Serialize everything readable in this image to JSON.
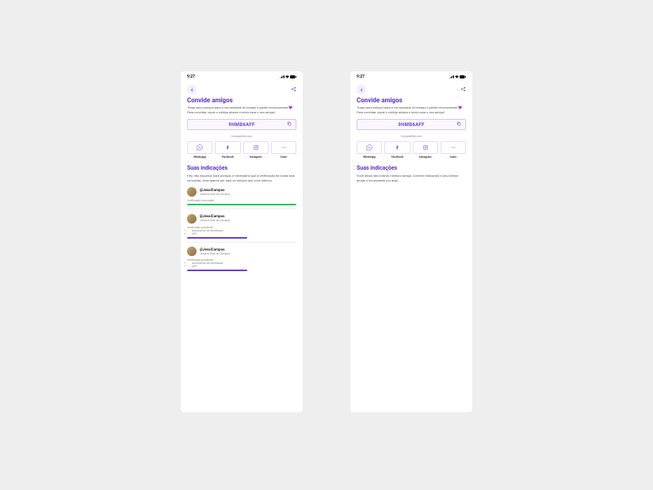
{
  "status": {
    "time": "9:27"
  },
  "header": {
    "title": "Convide amigos",
    "desc": "Traga seus amigos para a comunidade #Lovepay e ganhe recompensas 💜 Para convidar, copie o código abaixo e envie para o seu amigo!"
  },
  "code": {
    "value": "9HMB6AFF"
  },
  "share": {
    "label": "Compartilhe com",
    "items": [
      {
        "name": "WhatsApp"
      },
      {
        "name": "Facebook"
      },
      {
        "name": "Instagram"
      },
      {
        "name": "Outro"
      }
    ]
  },
  "referrals": {
    "title": "Suas indicações",
    "descFilled": "Hey, não esqueça: para pontuar, é necessário que a verificação de conta seja concluída.  Acompanhe por aqui os amigos que você indicou.",
    "descEmpty": "Você ainda não indicou nenhum amigo. Comece indicando o seu melhor amigo e acompanhe por aqui.",
    "items": [
      {
        "handle": "@JessiCampos",
        "full": "Jessica Dias de Campos",
        "status": "Verificação concluída!",
        "pending": [],
        "progress": 100,
        "color": "green"
      },
      {
        "handle": "@JessiCampos",
        "full": "Jessica Dias de Campos",
        "status": "Verificação pendente:",
        "pending": [
          "documento de identidade",
          "CPF"
        ],
        "progress": 55,
        "color": "purple"
      },
      {
        "handle": "@JessiCampos",
        "full": "Jessica Dias de Campos",
        "status": "Verificação pendente:",
        "pending": [
          "documento de identidade",
          "CPF"
        ],
        "progress": 55,
        "color": "purple"
      }
    ]
  }
}
